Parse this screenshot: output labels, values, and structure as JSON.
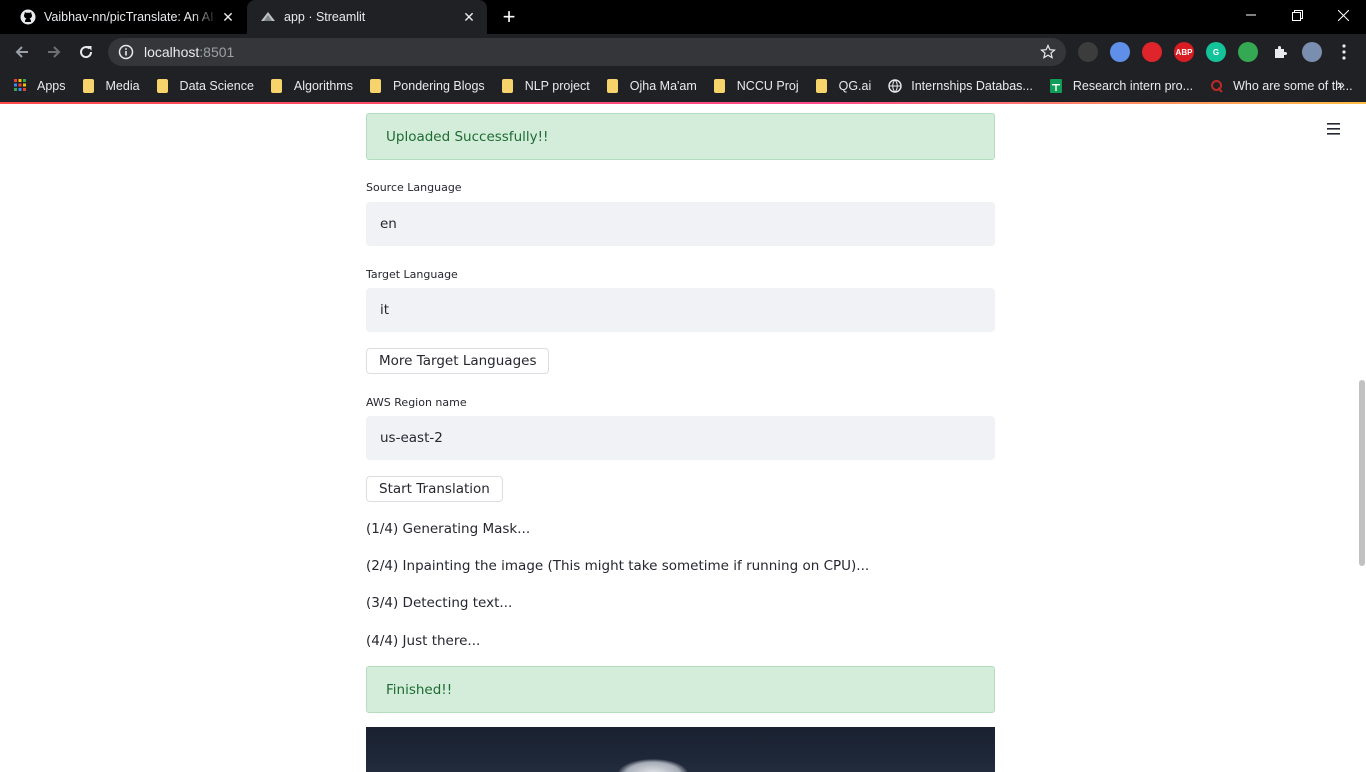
{
  "browser": {
    "tabs": [
      {
        "title": "Vaibhav-nn/picTranslate: An AI based",
        "icon": "github-icon",
        "active": false
      },
      {
        "title": "app · Streamlit",
        "icon": "streamlit-icon",
        "active": true
      }
    ],
    "url_host": "localhost",
    "url_port": ":8501",
    "bookmarks": [
      {
        "label": "Apps",
        "icon": "apps-grid-icon"
      },
      {
        "label": "Media",
        "icon": "folder-icon"
      },
      {
        "label": "Data Science",
        "icon": "folder-icon"
      },
      {
        "label": "Algorithms",
        "icon": "folder-icon"
      },
      {
        "label": "Pondering Blogs",
        "icon": "folder-icon"
      },
      {
        "label": "NLP project",
        "icon": "folder-icon"
      },
      {
        "label": "Ojha Ma'am",
        "icon": "folder-icon"
      },
      {
        "label": "NCCU Proj",
        "icon": "folder-icon"
      },
      {
        "label": "QG.ai",
        "icon": "folder-icon"
      },
      {
        "label": "Internships Databas...",
        "icon": "globe-icon"
      },
      {
        "label": "Research intern pro...",
        "icon": "sheets-icon"
      },
      {
        "label": "Who are some of th...",
        "icon": "quora-icon"
      }
    ],
    "extensions": [
      {
        "name": "extension-dark-icon",
        "color": "#3c3c3c",
        "text": ""
      },
      {
        "name": "extension-notify-icon",
        "color": "#5f8fe8",
        "text": ""
      },
      {
        "name": "stop-hand-icon",
        "color": "#e0242b",
        "text": ""
      },
      {
        "name": "adblock-plus-icon",
        "color": "#d81c22",
        "text": "ABP"
      },
      {
        "name": "grammarly-icon",
        "color": "#15c39a",
        "text": "G"
      },
      {
        "name": "mail-check-icon",
        "color": "#34a853",
        "text": ""
      },
      {
        "name": "puzzle-extensions-icon",
        "color": "transparent",
        "text": ""
      },
      {
        "name": "profile-avatar-icon",
        "color": "#7a8fb0",
        "text": ""
      }
    ]
  },
  "app": {
    "upload_status": "Uploaded Successfully!!",
    "source_language": {
      "label": "Source Language",
      "value": "en"
    },
    "target_language": {
      "label": "Target Language",
      "value": "it"
    },
    "more_languages_button": "More Target Languages",
    "aws_region": {
      "label": "AWS Region name",
      "value": "us-east-2"
    },
    "start_button": "Start Translation",
    "steps": [
      "(1/4) Generating Mask...",
      "(2/4) Inpainting the image (This might take sometime if running on CPU)...",
      "(3/4) Detecting text...",
      "(4/4) Just there..."
    ],
    "finished_status": "Finished!!"
  },
  "colors": {
    "success_bg": "#d4edda",
    "success_text": "#1d6b33",
    "input_bg": "#f0f2f6",
    "accent": "#ff4b4b"
  }
}
